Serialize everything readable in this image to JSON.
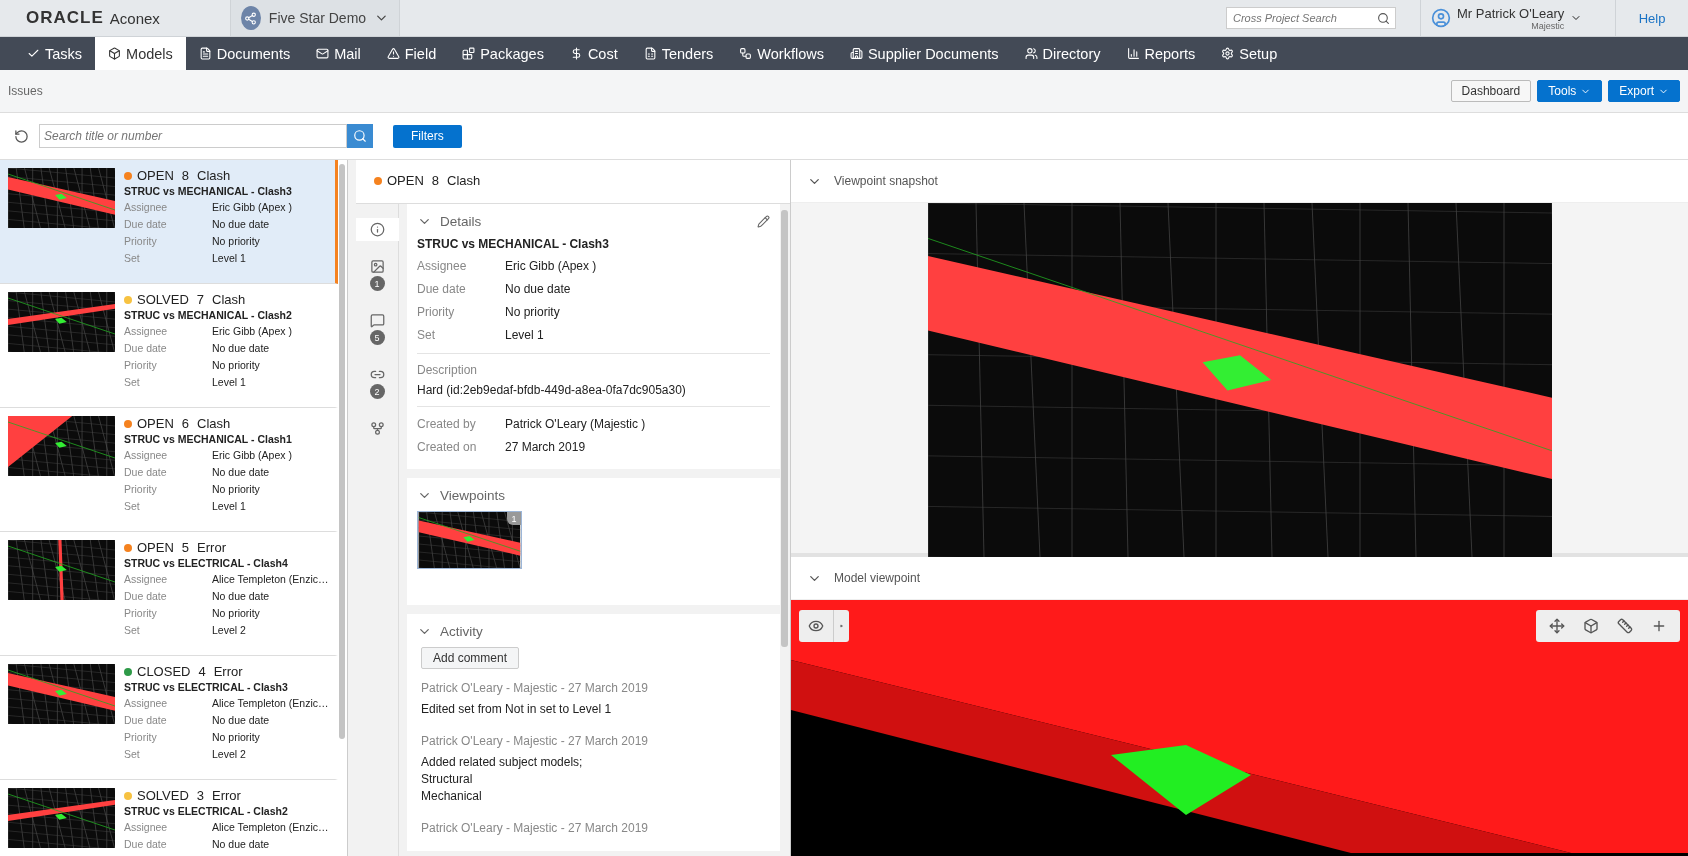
{
  "header": {
    "logo_brand": "ORACLE",
    "logo_product": "Aconex",
    "project": "Five Star Demo",
    "search": {
      "placeholder": "Cross Project Search"
    },
    "user": {
      "name": "Mr Patrick O'Leary",
      "org": "Majestic"
    },
    "help": "Help"
  },
  "nav": [
    {
      "label": "Tasks",
      "selected": false
    },
    {
      "label": "Models",
      "selected": true
    },
    {
      "label": "Documents",
      "selected": false
    },
    {
      "label": "Mail",
      "selected": false
    },
    {
      "label": "Field",
      "selected": false
    },
    {
      "label": "Packages",
      "selected": false
    },
    {
      "label": "Cost",
      "selected": false
    },
    {
      "label": "Tenders",
      "selected": false
    },
    {
      "label": "Workflows",
      "selected": false
    },
    {
      "label": "Supplier Documents",
      "selected": false
    },
    {
      "label": "Directory",
      "selected": false
    },
    {
      "label": "Reports",
      "selected": false
    },
    {
      "label": "Setup",
      "selected": false
    }
  ],
  "page": {
    "title": "Issues",
    "buttons": [
      {
        "label": "Dashboard",
        "kind": "plain"
      },
      {
        "label": "Tools",
        "kind": "menu"
      },
      {
        "label": "Export",
        "kind": "menu"
      }
    ]
  },
  "toolbar": {
    "search": {
      "placeholder": "Search title or number"
    },
    "filters": "Filters"
  },
  "issues": [
    {
      "status": "OPEN",
      "color": "#f5821f",
      "number": "8",
      "type": "Clash",
      "title": "STRUC vs MECHANICAL - Clash3",
      "selected": true,
      "fields": [
        {
          "label": "Assignee",
          "value": "Eric Gibb (Apex )"
        },
        {
          "label": "Due date",
          "value": "No due date"
        },
        {
          "label": "Priority",
          "value": "No priority"
        },
        {
          "label": "Set",
          "value": "Level 1"
        }
      ]
    },
    {
      "status": "SOLVED",
      "color": "#f7c241",
      "number": "7",
      "type": "Clash",
      "title": "STRUC vs MECHANICAL - Clash2",
      "selected": false,
      "fields": [
        {
          "label": "Assignee",
          "value": "Eric Gibb (Apex )"
        },
        {
          "label": "Due date",
          "value": "No due date"
        },
        {
          "label": "Priority",
          "value": "No priority"
        },
        {
          "label": "Set",
          "value": "Level 1"
        }
      ]
    },
    {
      "status": "OPEN",
      "color": "#f5821f",
      "number": "6",
      "type": "Clash",
      "title": "STRUC vs MECHANICAL - Clash1",
      "selected": false,
      "fields": [
        {
          "label": "Assignee",
          "value": "Eric Gibb (Apex )"
        },
        {
          "label": "Due date",
          "value": "No due date"
        },
        {
          "label": "Priority",
          "value": "No priority"
        },
        {
          "label": "Set",
          "value": "Level 1"
        }
      ]
    },
    {
      "status": "OPEN",
      "color": "#f5821f",
      "number": "5",
      "type": "Error",
      "title": "STRUC vs ELECTRICAL - Clash4",
      "selected": false,
      "fields": [
        {
          "label": "Assignee",
          "value": "Alice Templeton (Enzic…"
        },
        {
          "label": "Due date",
          "value": "No due date"
        },
        {
          "label": "Priority",
          "value": "No priority"
        },
        {
          "label": "Set",
          "value": "Level 2"
        }
      ]
    },
    {
      "status": "CLOSED",
      "color": "#2e9a48",
      "number": "4",
      "type": "Error",
      "title": "STRUC vs ELECTRICAL - Clash3",
      "selected": false,
      "fields": [
        {
          "label": "Assignee",
          "value": "Alice Templeton (Enzic…"
        },
        {
          "label": "Due date",
          "value": "No due date"
        },
        {
          "label": "Priority",
          "value": "No priority"
        },
        {
          "label": "Set",
          "value": "Level 2"
        }
      ]
    },
    {
      "status": "SOLVED",
      "color": "#f7c241",
      "number": "3",
      "type": "Error",
      "title": "STRUC vs ELECTRICAL - Clash2",
      "selected": false,
      "fields": [
        {
          "label": "Assignee",
          "value": "Alice Templeton (Enzic…"
        },
        {
          "label": "Due date",
          "value": "No due date"
        }
      ]
    }
  ],
  "detail": {
    "status": "OPEN",
    "color": "#f5821f",
    "number": "8",
    "type": "Clash",
    "side_tabs": [
      {
        "kind": "info",
        "selected": true
      },
      {
        "kind": "image",
        "count": "1",
        "selected": false
      },
      {
        "kind": "comment",
        "count": "5",
        "selected": false
      },
      {
        "kind": "link",
        "count": "2",
        "selected": false
      },
      {
        "kind": "branch",
        "selected": false
      }
    ],
    "details": {
      "heading": "Details",
      "title": "STRUC vs MECHANICAL - Clash3",
      "fields": [
        {
          "label": "Assignee",
          "value": "Eric Gibb (Apex )"
        },
        {
          "label": "Due date",
          "value": "No due date"
        },
        {
          "label": "Priority",
          "value": "No priority"
        },
        {
          "label": "Set",
          "value": "Level 1"
        }
      ],
      "description_label": "Description",
      "description": "Hard (id:2eb9edaf-bfdb-449d-a8ea-0fa7dc905a30)",
      "created": [
        {
          "label": "Created by",
          "value": "Patrick O'Leary (Majestic )"
        },
        {
          "label": "Created on",
          "value": "27 March 2019"
        }
      ]
    },
    "viewpoints": {
      "heading": "Viewpoints",
      "badge": "1"
    },
    "activity": {
      "heading": "Activity",
      "add_comment": "Add comment",
      "entries": [
        {
          "meta": "Patrick O'Leary - Majestic - 27 March 2019",
          "text": "Edited set from Not in set to Level 1"
        },
        {
          "meta": "Patrick O'Leary - Majestic - 27 March 2019",
          "text": "Added related subject models;\nStructural\nMechanical"
        },
        {
          "meta": "Patrick O'Leary - Majestic - 27 March 2019"
        }
      ]
    }
  },
  "right": {
    "snapshot_heading": "Viewpoint snapshot",
    "model_heading": "Model viewpoint"
  }
}
